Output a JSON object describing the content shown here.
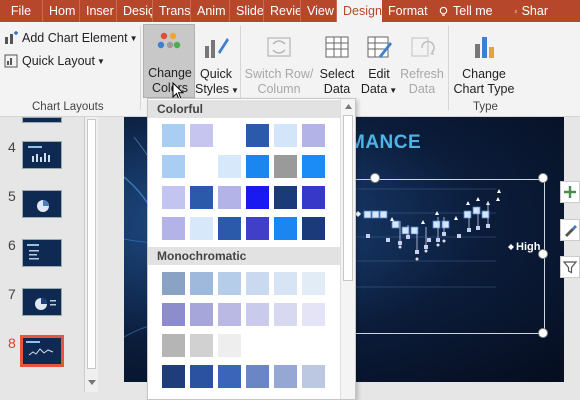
{
  "tabs": {
    "file": "File",
    "home": "Hom",
    "insert": "Inser",
    "design1": "Desiç",
    "transitions": "Trans",
    "animations": "Anim",
    "slide": "Slide",
    "review": "Revie",
    "view": "View",
    "design": "Design",
    "format": "Format",
    "tellme": "Tell me",
    "share": "Shar"
  },
  "ribbon": {
    "add_chart_element": "Add Chart Element",
    "quick_layout": "Quick Layout",
    "chart_layouts": "Chart Layouts",
    "change_colors_line1": "Change",
    "change_colors_line2": "Colors",
    "quick_styles_line1": "Quick",
    "quick_styles_line2": "Styles",
    "switch_row_line1": "Switch Row/",
    "switch_row_line2": "Column",
    "select_data_line1": "Select",
    "select_data_line2": "Data",
    "edit_data_line1": "Edit",
    "edit_data_line2": "Data",
    "refresh_data_line1": "Refresh",
    "refresh_data_line2": "Data",
    "change_chart_type_line1": "Change",
    "change_chart_type_line2": "Chart Type",
    "type_label": "Type"
  },
  "thumbnails": [
    "4",
    "5",
    "6",
    "7",
    "8"
  ],
  "slide": {
    "title_fragment": "MANCE",
    "legend_label": "High"
  },
  "dropdown": {
    "colorful_header": "Colorful",
    "monochromatic_header": "Monochromatic",
    "colorful_rows": [
      [
        "#a9cdf3",
        "#c5c5f0",
        "#ffffff",
        "#2b5aab",
        "#d3e5f8",
        "#b3b3e8"
      ],
      [
        "#a9cdf3",
        "#ffffff",
        "#d7e8fb",
        "#1b85f0",
        "#9a9a9a",
        "#1b8cf5"
      ],
      [
        "#c4c4f0",
        "#2b5aab",
        "#b3b3e8",
        "#1a1af0",
        "#1b3a7a",
        "#3838c8"
      ],
      [
        "#b3b3e8",
        "#d7e8fb",
        "#2b5aab",
        "#3f3fc8",
        "#1b85f0",
        "#1b3a7a"
      ]
    ],
    "mono_rows": [
      [
        "#8aa3c4",
        "#9fb9dc",
        "#b6cde9",
        "#c9daf0",
        "#d7e4f4",
        "#e2ecf7"
      ],
      [
        "#8d8ccc",
        "#a7a6db",
        "#b9b9e4",
        "#cacaec",
        "#d8d8f1",
        "#e4e4f6"
      ],
      [
        "#b5b5b5",
        "#d1d1d1",
        "#eeeeee",
        "#ffffff",
        "#ffffff",
        "#ffffff"
      ],
      [
        "#1f3d7a",
        "#2b52a0",
        "#3a65b8",
        "#6a86c4",
        "#95a8d3",
        "#bcc8e2"
      ]
    ]
  },
  "colors": {
    "tab_bar": "#b7472a",
    "ribbon_bg": "#f3f3f3",
    "selected_thumb_border": "#e8553a",
    "slide_title": "#4fb3e8"
  }
}
